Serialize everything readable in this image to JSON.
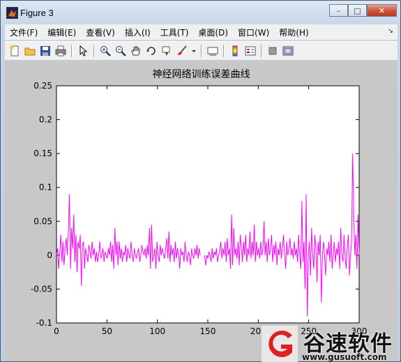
{
  "window": {
    "title": "Figure 3",
    "minimize": "–",
    "maximize": "□",
    "close": "✕"
  },
  "menu": [
    "文件(F)",
    "编辑(E)",
    "查看(V)",
    "插入(I)",
    "工具(T)",
    "桌面(D)",
    "窗口(W)",
    "帮助(H)"
  ],
  "menu_overflow": "↘",
  "toolbar": [
    "new-file-icon",
    "open-folder-icon",
    "save-icon",
    "print-icon",
    "|",
    "pointer-icon",
    "|",
    "zoom-in-icon",
    "zoom-out-icon",
    "pan-hand-icon",
    "rotate-3d-icon",
    "data-cursor-icon",
    "brush-icon",
    "dropdown-arrow-icon",
    "|",
    "link-plot-icon",
    "|",
    "colorbar-icon",
    "legend-icon",
    "|",
    "hide-plot-tools-icon",
    "show-plot-tools-icon"
  ],
  "watermark": {
    "brand": "谷速软件",
    "url": "www.gusuoft.com"
  },
  "chart_data": {
    "type": "line",
    "title": "神经网络训练误差曲线",
    "xlabel": "",
    "ylabel": "",
    "xlim": [
      0,
      300
    ],
    "ylim": [
      -0.1,
      0.25
    ],
    "xticks": [
      0,
      50,
      100,
      150,
      200,
      250,
      300
    ],
    "yticks": [
      -0.1,
      -0.05,
      0,
      0.05,
      0.1,
      0.15,
      0.2,
      0.25
    ],
    "ytick_labels": [
      "-0.1",
      "-0.05",
      "0",
      "0.05",
      "0.1",
      "0.15",
      "0.2",
      "0.25"
    ],
    "grid": false,
    "line_color": "#ff00ff",
    "series": [
      {
        "values": [
          0.0,
          0.01,
          -0.02,
          0.005,
          0.03,
          -0.01,
          0.02,
          -0.015,
          0.01,
          0.025,
          0.0,
          0.035,
          0.09,
          -0.02,
          0.04,
          0.01,
          0.06,
          -0.01,
          0.03,
          -0.025,
          0.02,
          0.01,
          0.03,
          -0.045,
          0.015,
          0.02,
          -0.02,
          0.01,
          0.0,
          -0.01,
          0.015,
          0.005,
          -0.005,
          0.02,
          0.0,
          0.01,
          -0.01,
          0.005,
          -0.01,
          0.0,
          0.02,
          -0.005,
          0.0,
          0.01,
          -0.01,
          0.005,
          0.0,
          -0.005,
          0.01,
          0.0,
          0.02,
          -0.01,
          0.015,
          -0.02,
          0.04,
          0.0,
          0.02,
          -0.015,
          0.02,
          -0.005,
          0.01,
          -0.01,
          0.005,
          0.0,
          0.015,
          -0.01,
          0.01,
          0.0,
          -0.005,
          0.02,
          0.0,
          -0.01,
          0.01,
          0.0,
          -0.005,
          0.005,
          0.01,
          -0.01,
          0.0,
          0.015,
          0.005,
          0.0,
          0.01,
          -0.005,
          0.015,
          0.0,
          0.04,
          -0.02,
          0.045,
          -0.01,
          0.0,
          0.01,
          -0.02,
          0.02,
          0.0,
          -0.01,
          0.015,
          0.0,
          0.01,
          0.0,
          -0.005,
          0.01,
          0.025,
          -0.005,
          0.035,
          -0.01,
          0.015,
          0.0,
          0.01,
          -0.01,
          0.02,
          -0.005,
          0.01,
          0.0,
          -0.02,
          0.01,
          0.0,
          0.005,
          -0.01,
          0.02,
          0.0,
          -0.01,
          0.005,
          0.0,
          -0.015,
          0.01,
          0.0,
          -0.005,
          0.01,
          0.0,
          0.015,
          -0.005,
          0.01,
          0.0,
          null,
          null,
          null,
          0.0,
          -0.015,
          0.0,
          -0.005,
          0.005,
          0.0,
          -0.01,
          0.01,
          -0.005,
          0.005,
          0.0,
          0.01,
          -0.01,
          0.0,
          0.005,
          0.02,
          -0.005,
          0.01,
          0.0,
          0.02,
          -0.01,
          0.025,
          0.0,
          0.01,
          -0.02,
          0.06,
          -0.015,
          0.04,
          0.0,
          0.01,
          -0.005,
          0.02,
          -0.015,
          0.03,
          0.01,
          -0.01,
          0.02,
          0.0,
          0.03,
          -0.01,
          0.01,
          0.0,
          0.035,
          -0.005,
          0.02,
          0.0,
          0.045,
          -0.01,
          0.02,
          0.0,
          0.01,
          -0.005,
          0.02,
          0.0,
          0.01,
          0.05,
          0.0,
          0.02,
          -0.01,
          0.025,
          0.0,
          0.01,
          0.03,
          -0.01,
          0.015,
          0.0,
          0.02,
          -0.015,
          0.01,
          0.0,
          0.02,
          -0.005,
          0.01,
          0.03,
          0.0,
          -0.02,
          0.02,
          0.0,
          0.01,
          0.025,
          0.0,
          0.01,
          -0.005,
          0.02,
          0.0,
          0.01,
          -0.01,
          0.03,
          0.0,
          -0.02,
          0.08,
          -0.01,
          0.02,
          -0.05,
          0.09,
          -0.09,
          0.0,
          0.02,
          -0.03,
          0.04,
          0.0,
          -0.02,
          0.03,
          0.01,
          -0.04,
          0.02,
          0.0,
          0.03,
          -0.07,
          0.0,
          0.02,
          0.0,
          -0.03,
          0.01,
          0.0,
          0.02,
          -0.01,
          0.03,
          -0.02,
          0.0,
          0.02,
          -0.01,
          0.01,
          0.0,
          0.02,
          -0.02,
          0.04,
          0.0,
          -0.01,
          0.03,
          0.0,
          -0.02,
          0.01,
          0.03,
          -0.03,
          0.0,
          0.02,
          0.15,
          0.06,
          0.0,
          0.03,
          -0.02,
          0.06,
          0.0
        ]
      }
    ]
  }
}
